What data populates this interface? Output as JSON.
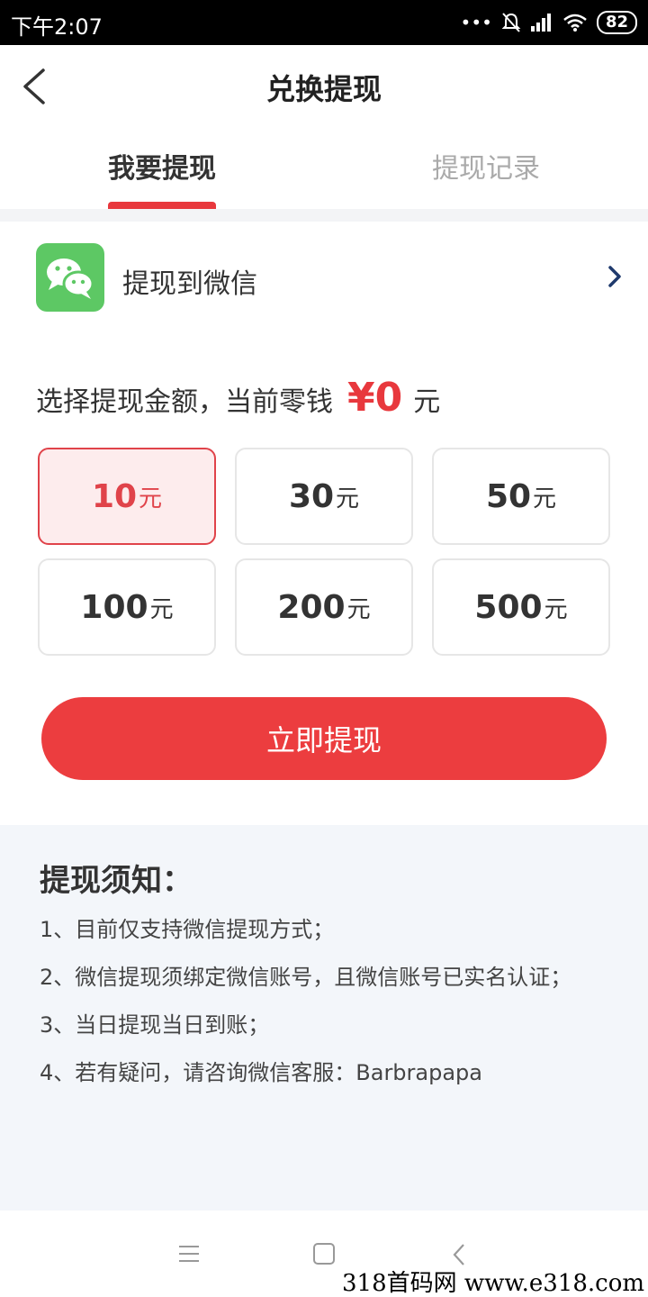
{
  "status_bar": {
    "time": "下午2:07",
    "battery": "82"
  },
  "header": {
    "title": "兑换提现"
  },
  "tabs": [
    {
      "label": "我要提现",
      "active": true
    },
    {
      "label": "提现记录",
      "active": false
    }
  ],
  "payout": {
    "label": "提现到微信"
  },
  "amount": {
    "prompt": "选择提现金额，当前零钱",
    "value": "¥0",
    "unit": "元"
  },
  "options": [
    {
      "value": "10",
      "unit": "元",
      "selected": true
    },
    {
      "value": "30",
      "unit": "元",
      "selected": false
    },
    {
      "value": "50",
      "unit": "元",
      "selected": false
    },
    {
      "value": "100",
      "unit": "元",
      "selected": false
    },
    {
      "value": "200",
      "unit": "元",
      "selected": false
    },
    {
      "value": "500",
      "unit": "元",
      "selected": false
    }
  ],
  "submit_label": "立即提现",
  "notes": {
    "title": "提现须知：",
    "items": [
      "1、目前仅支持微信提现方式；",
      "2、微信提现须绑定微信账号，且微信账号已实名认证；",
      "3、当日提现当日到账；",
      "4、若有疑问，请咨询微信客服：Barbrapapa"
    ]
  },
  "watermark": "318首码网  www.e318.com",
  "colors": {
    "accent": "#e8383d",
    "wechat_green": "#5dc864",
    "selected_bg": "#fdeced",
    "notes_bg": "#f3f6fa"
  },
  "icons": {
    "back": "chevron-left-icon",
    "wechat": "wechat-icon",
    "row_arrow": "chevron-right-icon",
    "nav": [
      "menu-icon",
      "home-icon",
      "back-icon"
    ]
  }
}
